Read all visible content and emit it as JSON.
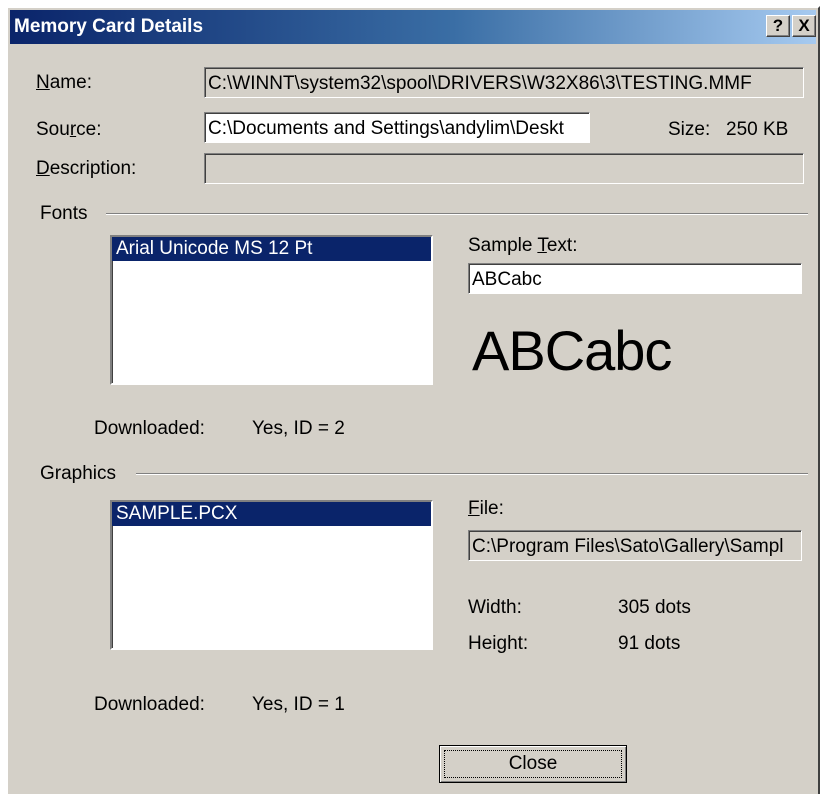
{
  "window": {
    "title": "Memory Card Details",
    "help_button": "?",
    "close_button": "X"
  },
  "name": {
    "label_pre": "",
    "label_key": "N",
    "label_post": "ame:",
    "value": "C:\\WINNT\\system32\\spool\\DRIVERS\\W32X86\\3\\TESTING.MMF"
  },
  "source": {
    "label_pre": "Sou",
    "label_key": "r",
    "label_post": "ce:",
    "value": "C:\\Documents and Settings\\andylim\\Deskt"
  },
  "size": {
    "label": "Size:",
    "value": "250 KB"
  },
  "description": {
    "label_pre": "",
    "label_key": "D",
    "label_post": "escription:",
    "value": ""
  },
  "fonts": {
    "group_label": "Fonts",
    "items": [
      "Arial Unicode MS 12 Pt"
    ],
    "sample_label_pre": "Sample ",
    "sample_label_key": "T",
    "sample_label_post": "ext:",
    "sample_value": "ABCabc",
    "preview": "ABCabc",
    "downloaded_label": "Downloaded:",
    "downloaded_value": "Yes, ID = 2"
  },
  "graphics": {
    "group_label": "Graphics",
    "items": [
      "SAMPLE.PCX"
    ],
    "file_label_pre": "",
    "file_label_key": "F",
    "file_label_post": "ile:",
    "file_value": "C:\\Program Files\\Sato\\Gallery\\Sampl",
    "width_label": "Width:",
    "width_value": "305 dots",
    "height_label": "Height:",
    "height_value": "91 dots",
    "downloaded_label": "Downloaded:",
    "downloaded_value": "Yes, ID = 1"
  },
  "close_label": "Close",
  "colors": {
    "titlebar_start": "#0a246a",
    "titlebar_end": "#a6caf0",
    "face": "#d4d0c8",
    "selection": "#0a246a"
  }
}
